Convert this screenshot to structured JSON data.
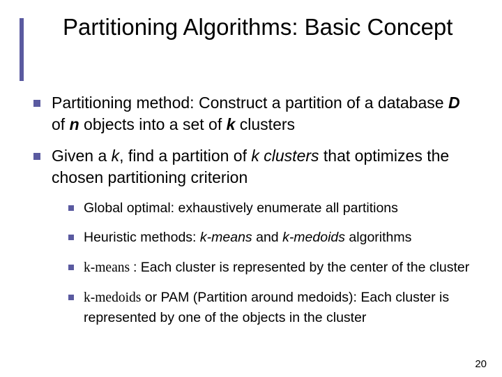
{
  "title": "Partitioning Algorithms: Basic Concept",
  "page_number": "20",
  "bullets": {
    "b1": {
      "t1": "Partitioning method: Construct a partition of a database ",
      "D": "D",
      "t2": " of ",
      "n": "n",
      "t3": " objects into a set of ",
      "k": "k",
      "t4": " clusters"
    },
    "b2": {
      "t1": "Given a ",
      "k1": "k",
      "t2": ", find a partition of ",
      "kc": "k clusters ",
      "t3": "that optimizes the chosen partitioning criterion",
      "sub": {
        "s1": "Global optimal: exhaustively enumerate all partitions",
        "s2": {
          "t1": "Heuristic methods: ",
          "km": "k-means",
          "t2": " and ",
          "kmed": "k-medoids",
          "t3": " algorithms"
        },
        "s3": {
          "km": "k-means ",
          "t1": ": Each cluster is represented by the center of the cluster"
        },
        "s4": {
          "kmed": "k-medoids",
          "t1": " or PAM (Partition around medoids): Each cluster is represented by one of the objects in the cluster"
        }
      }
    }
  }
}
